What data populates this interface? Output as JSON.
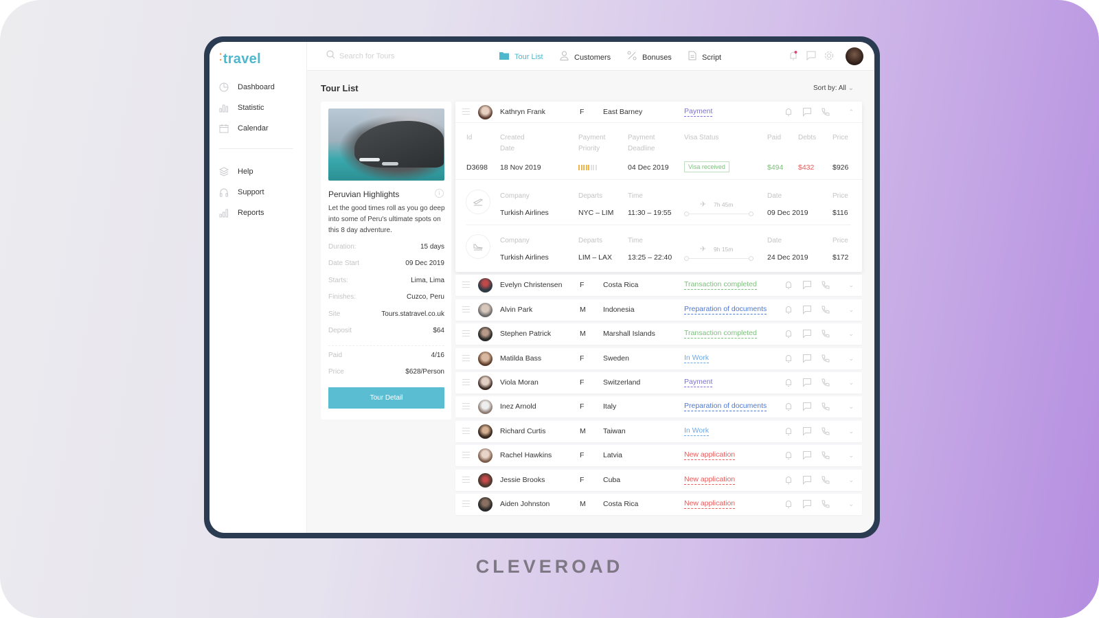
{
  "brand": "CLEVEROAD",
  "app": {
    "logo": "travel",
    "logo_dots": "⁚",
    "accent_color": "#4fb7cc"
  },
  "sidebar": {
    "items": [
      {
        "label": "Dashboard",
        "icon": "pie-chart-icon"
      },
      {
        "label": "Statistic",
        "icon": "bar-chart-icon"
      },
      {
        "label": "Calendar",
        "icon": "calendar-icon"
      },
      {
        "label": "Help",
        "icon": "layers-icon"
      },
      {
        "label": "Support",
        "icon": "headphones-icon"
      },
      {
        "label": "Reports",
        "icon": "bar-chart-icon"
      }
    ]
  },
  "topbar": {
    "search_placeholder": "Search for Tours",
    "nav": [
      {
        "label": "Tour List",
        "icon": "folder-icon",
        "active": true
      },
      {
        "label": "Customers",
        "icon": "user-icon"
      },
      {
        "label": "Bonuses",
        "icon": "percent-icon"
      },
      {
        "label": "Script",
        "icon": "document-icon"
      }
    ]
  },
  "main": {
    "title": "Tour List",
    "sort_label": "Sort by: All"
  },
  "tour": {
    "name": "Peruvian Highlights",
    "description": "Let the good times roll as you go deep into some of Peru's ultimate spots on this 8 day adventure.",
    "details": [
      {
        "key": "Duration:",
        "value": "15 days"
      },
      {
        "key": "Date Start",
        "value": "09 Dec 2019"
      },
      {
        "key": "Starts:",
        "value": "Lima, Lima"
      },
      {
        "key": "Finishes:",
        "value": "Cuzco, Peru"
      },
      {
        "key": "Site",
        "value": "Tours.statravel.co.uk"
      },
      {
        "key": "Deposit",
        "value": "$64"
      },
      {
        "key": "Paid",
        "value": "4/16"
      },
      {
        "key": "Price",
        "value": "$628/Person"
      }
    ],
    "button_label": "Tour Detail"
  },
  "expanded": {
    "name": "Kathryn Frank",
    "gender": "F",
    "country": "East Barney",
    "status": "Payment",
    "headers": {
      "id": "Id",
      "created": "Created Date",
      "priority": "Payment Priority",
      "deadline": "Payment Deadline",
      "visa": "Visa Status",
      "paid": "Paid",
      "debts": "Debts",
      "price": "Price"
    },
    "values": {
      "id": "D3698",
      "created": "18 Nov 2019",
      "priority_level": 5,
      "priority_max": 8,
      "deadline": "04 Dec 2019",
      "visa": "Visa received",
      "paid": "$494",
      "debts": "$432",
      "price": "$926"
    },
    "flight_headers": {
      "company": "Company",
      "departs": "Departs",
      "time": "Time",
      "date": "Date",
      "price": "Price"
    },
    "flights": [
      {
        "type": "departure",
        "company": "Turkish Airlines",
        "departs": "NYC – LIM",
        "time": "11:30 – 19:55",
        "duration": "7h 45m",
        "date": "09 Dec 2019",
        "price": "$116"
      },
      {
        "type": "arrival",
        "company": "Turkish Airlines",
        "departs": "LIM – LAX",
        "time": "13:25 – 22:40",
        "duration": "9h 15m",
        "date": "24 Dec 2019",
        "price": "$172"
      }
    ]
  },
  "status_colors": {
    "Payment": "#7b6fe0",
    "Transaction completed": "#7cbf7c",
    "Preparation of documents": "#4a78d8",
    "In Work": "#6aa8e8",
    "New application": "#e85a5a"
  },
  "customers": [
    {
      "name": "Evelyn Christensen",
      "gender": "F",
      "country": "Costa Rica",
      "status": "Transaction completed"
    },
    {
      "name": "Alvin Park",
      "gender": "M",
      "country": "Indonesia",
      "status": "Preparation of documents"
    },
    {
      "name": "Stephen Patrick",
      "gender": "M",
      "country": "Marshall Islands",
      "status": "Transaction completed"
    },
    {
      "name": "Matilda Bass",
      "gender": "F",
      "country": "Sweden",
      "status": "In Work"
    },
    {
      "name": "Viola Moran",
      "gender": "F",
      "country": "Switzerland",
      "status": "Payment"
    },
    {
      "name": "Inez Arnold",
      "gender": "F",
      "country": "Italy",
      "status": "Preparation of documents"
    },
    {
      "name": "Richard Curtis",
      "gender": "M",
      "country": "Taiwan",
      "status": "In Work"
    },
    {
      "name": "Rachel Hawkins",
      "gender": "F",
      "country": "Latvia",
      "status": "New application"
    },
    {
      "name": "Jessie Brooks",
      "gender": "F",
      "country": "Cuba",
      "status": "New application"
    },
    {
      "name": "Aiden Johnston",
      "gender": "M",
      "country": "Costa Rica",
      "status": "New application"
    }
  ]
}
